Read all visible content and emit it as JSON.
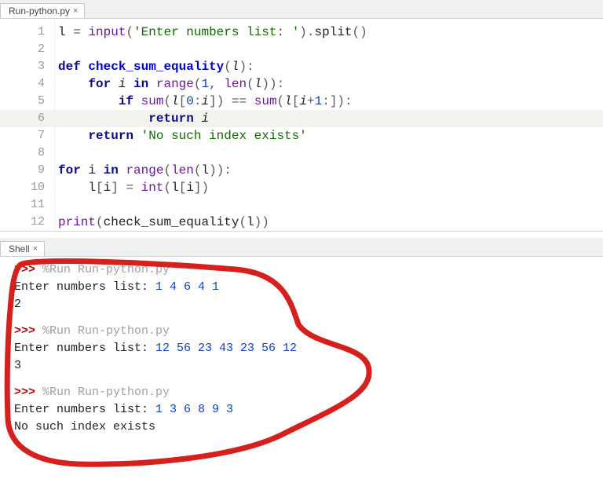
{
  "editor_tab": {
    "label": "Run-python.py"
  },
  "shell_tab": {
    "label": "Shell"
  },
  "code": {
    "lines": [
      {
        "n": 1,
        "hl": false
      },
      {
        "n": 2,
        "hl": false
      },
      {
        "n": 3,
        "hl": false
      },
      {
        "n": 4,
        "hl": false
      },
      {
        "n": 5,
        "hl": false
      },
      {
        "n": 6,
        "hl": true
      },
      {
        "n": 7,
        "hl": false
      },
      {
        "n": 8,
        "hl": false
      },
      {
        "n": 9,
        "hl": false
      },
      {
        "n": 10,
        "hl": false
      },
      {
        "n": 11,
        "hl": false
      },
      {
        "n": 12,
        "hl": false
      }
    ],
    "l1": {
      "var": "l",
      "eq": "=",
      "fn": "input",
      "lp": "(",
      "str": "'Enter numbers list: '",
      "rp": ")",
      "dot": ".",
      "m": "split",
      "lp2": "(",
      "rp2": ")"
    },
    "l3": {
      "kw": "def",
      "name": "check_sum_equality",
      "lp": "(",
      "p": "l",
      "rp": ")",
      "colon": ":"
    },
    "l4": {
      "kw": "for",
      "i": "i",
      "in": "in",
      "fn": "range",
      "lp": "(",
      "n1": "1",
      "comma": ",",
      "fn2": "len",
      "lp2": "(",
      "p": "l",
      "rp2": ")",
      "rp": ")",
      "colon": ":"
    },
    "l5": {
      "kw": "if",
      "fn": "sum",
      "lp": "(",
      "p": "l",
      "lb": "[",
      "n0": "0",
      "colon": ":",
      "i": "i",
      "rb": "]",
      "rp": ")",
      "eq": "==",
      "fn2": "sum",
      "lp2": "(",
      "p2": "l",
      "lb2": "[",
      "i2": "i",
      "plus": "+",
      "n1": "1",
      "colon2": ":",
      "rb2": "]",
      "rp2": ")",
      "colon3": ":"
    },
    "l6": {
      "kw": "return",
      "i": "i"
    },
    "l7": {
      "kw": "return",
      "str": "'No such index exists'"
    },
    "l9": {
      "kw": "for",
      "i": "i",
      "in": "in",
      "fn": "range",
      "lp": "(",
      "fn2": "len",
      "lp2": "(",
      "p": "l",
      "rp2": ")",
      "rp": ")",
      "colon": ":"
    },
    "l10": {
      "p": "l",
      "lb": "[",
      "i": "i",
      "rb": "]",
      "eq": "=",
      "fn": "int",
      "lp": "(",
      "p2": "l",
      "lb2": "[",
      "i2": "i",
      "rb2": "]",
      "rp": ")"
    },
    "l12": {
      "fn": "print",
      "lp": "(",
      "call": "check_sum_equality",
      "lp2": "(",
      "p": "l",
      "rp2": ")",
      "rp": ")"
    }
  },
  "shell": {
    "prompt": ">>>",
    "run_cmd": "%Run Run-python.py",
    "input_label": "Enter numbers list: ",
    "runs": [
      {
        "input": "1 4 6 4 1",
        "output": "2"
      },
      {
        "input": "12 56 23 43 23 56 12",
        "output": "3"
      },
      {
        "input": "1 3 6 8 9 3",
        "output": "No such index exists"
      }
    ]
  }
}
